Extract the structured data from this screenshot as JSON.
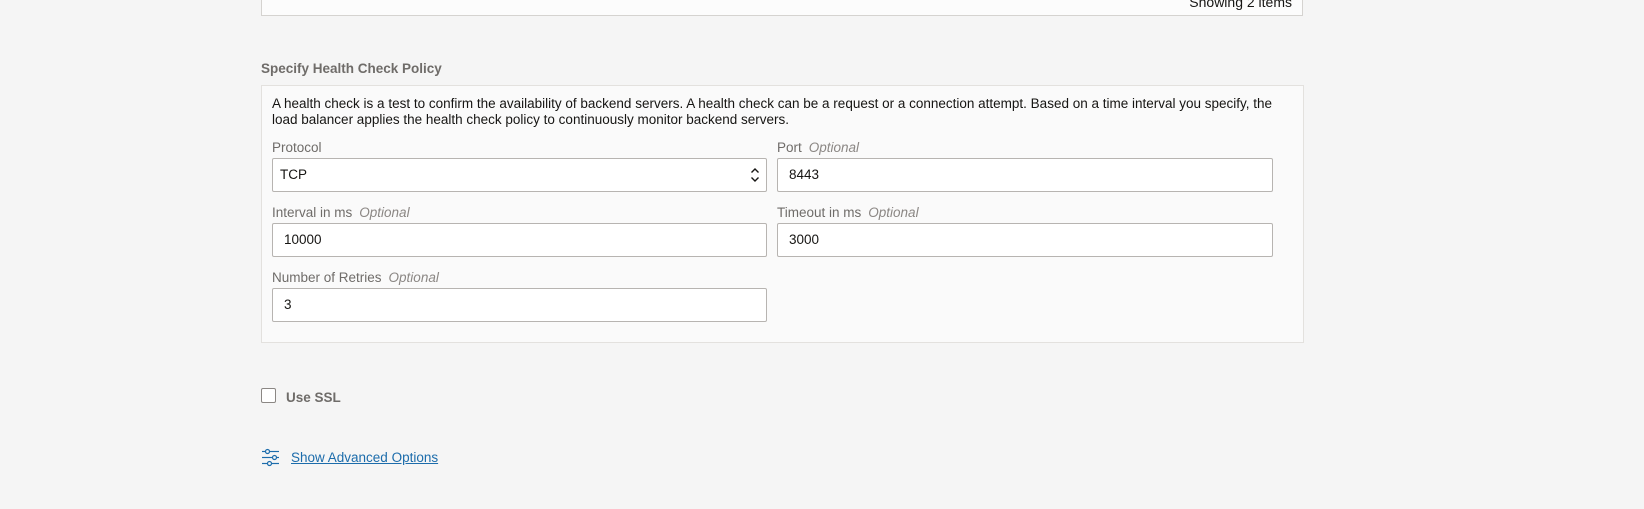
{
  "listing": {
    "status_text": "Showing 2 items"
  },
  "health_check": {
    "section_title": "Specify Health Check Policy",
    "description": "A health check is a test to confirm the availability of backend servers. A health check can be a request or a connection attempt. Based on a time interval you specify, the load balancer applies the health check policy to continuously monitor backend servers.",
    "protocol": {
      "label": "Protocol",
      "value": "TCP"
    },
    "port": {
      "label": "Port",
      "optional": "Optional",
      "value": "8443"
    },
    "interval": {
      "label": "Interval in ms",
      "optional": "Optional",
      "value": "10000"
    },
    "timeout": {
      "label": "Timeout in ms",
      "optional": "Optional",
      "value": "3000"
    },
    "retries": {
      "label": "Number of Retries",
      "optional": "Optional",
      "value": "3"
    }
  },
  "ssl": {
    "label": "Use SSL",
    "checked": false
  },
  "advanced": {
    "icon": "sliders-icon",
    "label": "Show Advanced Options"
  },
  "colors": {
    "link": "#1c6cab",
    "label": "#6f6c69",
    "background": "#f5f5f5"
  }
}
